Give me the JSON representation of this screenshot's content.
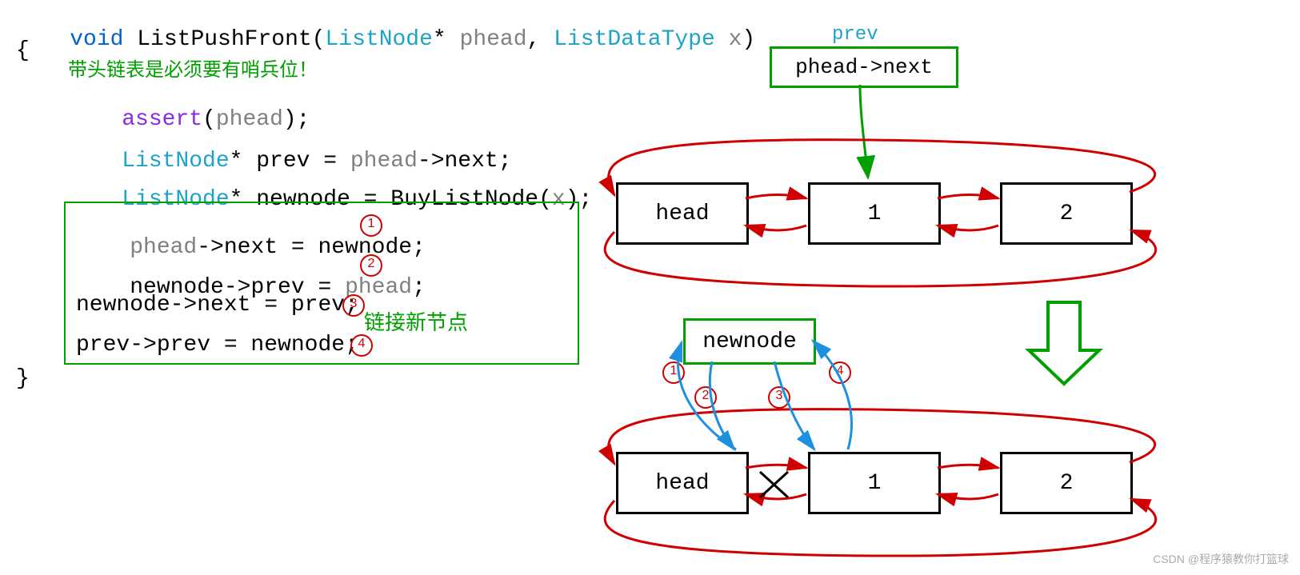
{
  "code": {
    "l1_void": "void ",
    "l1_fn": "ListPushFront",
    "l1_p1t": "ListNode",
    "l1_p1n": " phead",
    "l1_p2t": "ListDataType",
    "l1_p2n": " x",
    "l2_brace": "{",
    "l3_comment": "带头链表是必须要有哨兵位！",
    "l4_assert": "assert",
    "l4_arg": "phead",
    "l5_type": "ListNode",
    "l5_rest": "* prev = ",
    "l5_ph": "phead",
    "l5_tail": "->next;",
    "l6_type": "ListNode",
    "l6_rest": "* newnode = BuyListNode(",
    "l6_x": "x",
    "l6_close": ");",
    "l7_ph": "phead",
    "l7_rest": "->next = newnode; ",
    "l8": "newnode->prev = ",
    "l8_ph": "phead",
    "l8_tail": "; ",
    "l9": "newnode->next = prev;",
    "l10": "prev->prev = newnode;",
    "l_close": "}",
    "comment_link": "链接新节点"
  },
  "marks": {
    "m1": "1",
    "m2": "2",
    "m3": "3",
    "m4": "4"
  },
  "diagram": {
    "prev_label": "prev",
    "pheadnext": "phead->next",
    "head": "head",
    "n1": "1",
    "n2": "2",
    "newnode": "newnode"
  },
  "watermark": "CSDN @程序猿教你打篮球"
}
